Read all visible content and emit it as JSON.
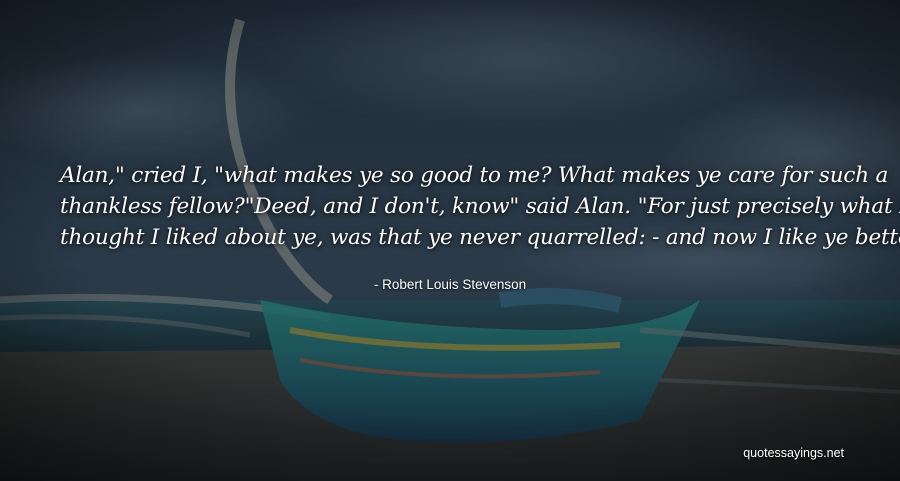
{
  "quote": {
    "lines": [
      "Alan,\" cried I, \"what makes ye so good to me? What makes ye care for such a",
      "thankless fellow?\"Deed, and I don't, know\" said Alan. \"For just precisely what I",
      "thought I liked about ye, was that ye never quarrelled: - and now I like ye better!"
    ],
    "author": "- Robert Louis Stevenson"
  },
  "watermark": "quotessayings.net",
  "colors": {
    "sky_top": "#2c3a48",
    "sky_bottom": "#3e5566",
    "sea": "#24434d",
    "sand": "#3a3d3a",
    "boat_teal": "#2f8f86",
    "boat_blue": "#1f4a7a",
    "boat_yellow": "#b8a23a",
    "text": "#ffffff"
  }
}
